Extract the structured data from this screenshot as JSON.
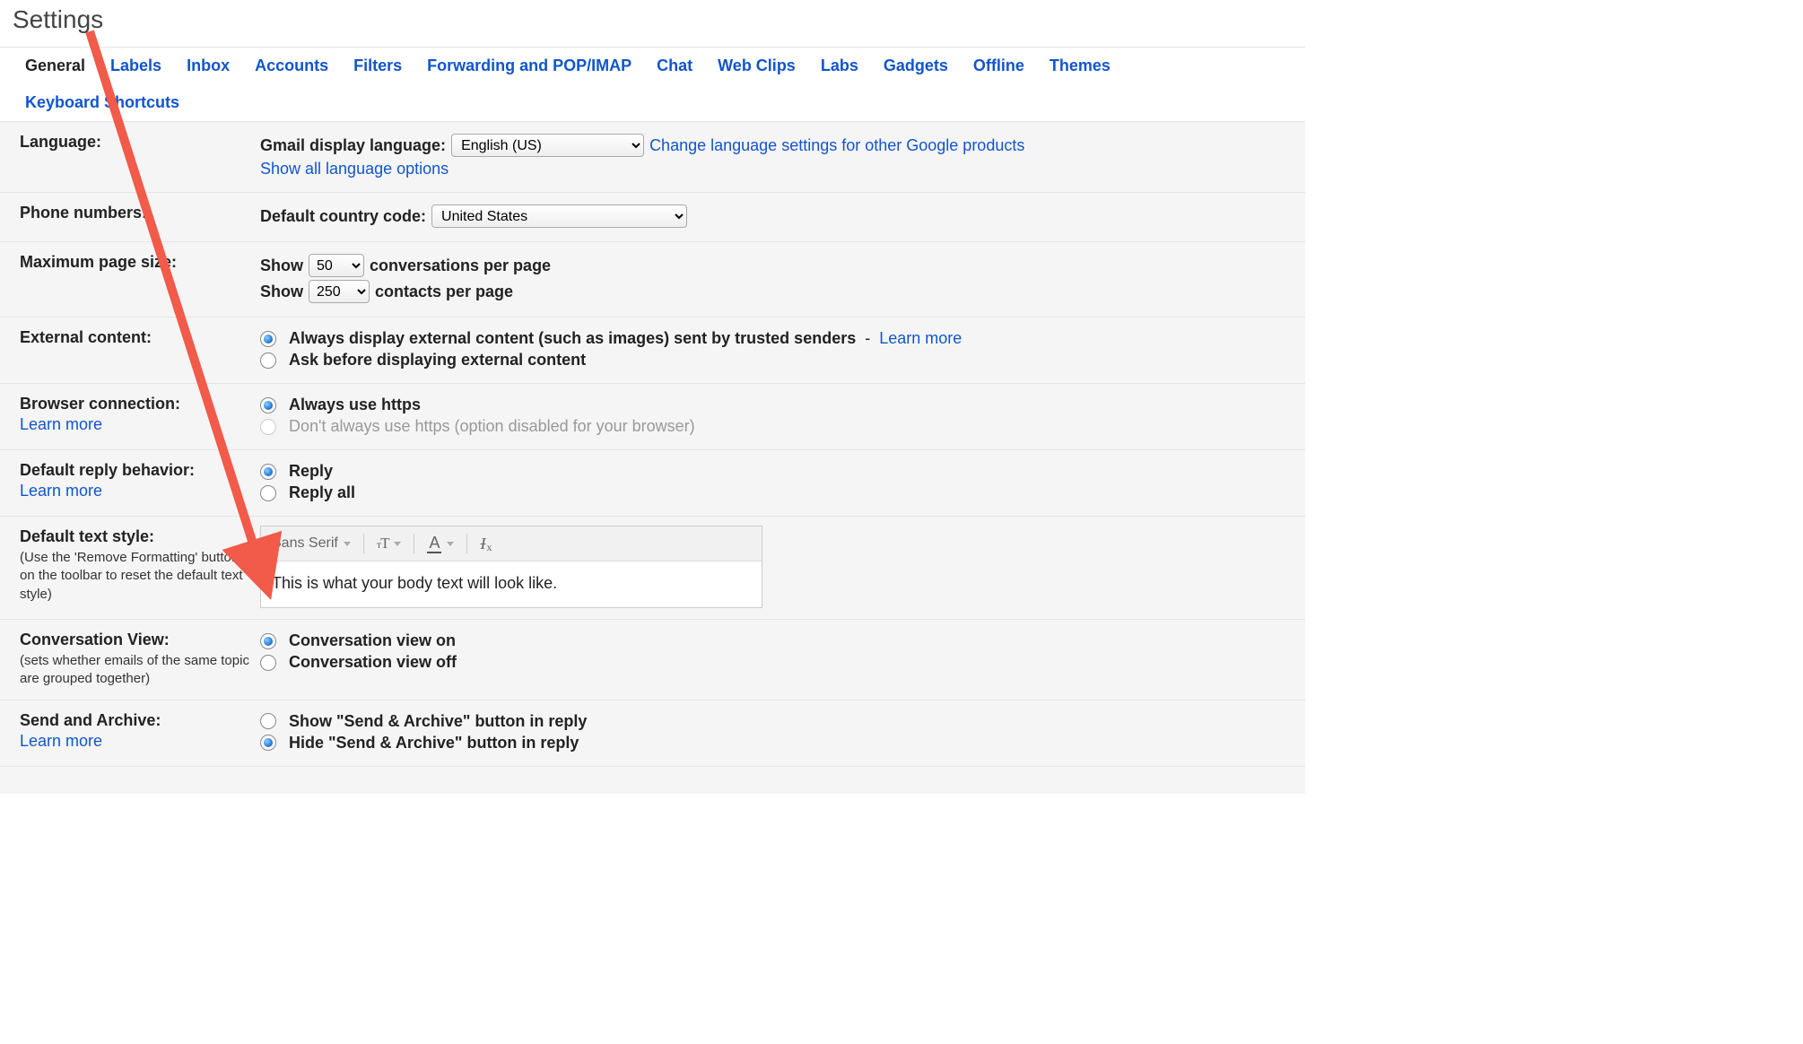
{
  "title": "Settings",
  "tabs": [
    "General",
    "Labels",
    "Inbox",
    "Accounts",
    "Filters",
    "Forwarding and POP/IMAP",
    "Chat",
    "Web Clips",
    "Labs",
    "Gadgets",
    "Offline",
    "Themes",
    "Keyboard Shortcuts"
  ],
  "active_tab": "General",
  "language": {
    "label": "Language:",
    "display_label": "Gmail display language:",
    "selected": "English (US)",
    "change_link": "Change language settings for other Google products",
    "show_all": "Show all language options"
  },
  "phone": {
    "label": "Phone numbers:",
    "default_code_label": "Default country code:",
    "selected_country": "United States"
  },
  "page_size": {
    "label": "Maximum page size:",
    "show_word": "Show",
    "conv_value": "50",
    "conv_suffix": "conversations per page",
    "contacts_value": "250",
    "contacts_suffix": "contacts per page"
  },
  "external": {
    "label": "External content:",
    "opt1_main": "Always display external content (such as images) sent by trusted senders",
    "opt1_dash": "-",
    "opt1_link": "Learn more",
    "opt2": "Ask before displaying external content",
    "selected": 0
  },
  "browser": {
    "label": "Browser connection:",
    "learn_more": "Learn more",
    "opt1": "Always use https",
    "opt2": "Don't always use https (option disabled for your browser)",
    "selected": 0
  },
  "reply": {
    "label": "Default reply behavior:",
    "learn_more": "Learn more",
    "opt1": "Reply",
    "opt2": "Reply all",
    "selected": 0
  },
  "text_style": {
    "label": "Default text style:",
    "hint": "(Use the 'Remove Formatting' button on the toolbar to reset the default text style)",
    "font_name": "Sans Serif",
    "preview": "This is what your body text will look like."
  },
  "conversation": {
    "label": "Conversation View:",
    "hint": "(sets whether emails of the same topic are grouped together)",
    "opt1": "Conversation view on",
    "opt2": "Conversation view off",
    "selected": 0
  },
  "send_archive": {
    "label": "Send and Archive:",
    "learn_more": "Learn more",
    "opt1": "Show \"Send & Archive\" button in reply",
    "opt2": "Hide \"Send & Archive\" button in reply",
    "selected": 1
  },
  "annotation": {
    "arrow_color": "#f25a49"
  }
}
